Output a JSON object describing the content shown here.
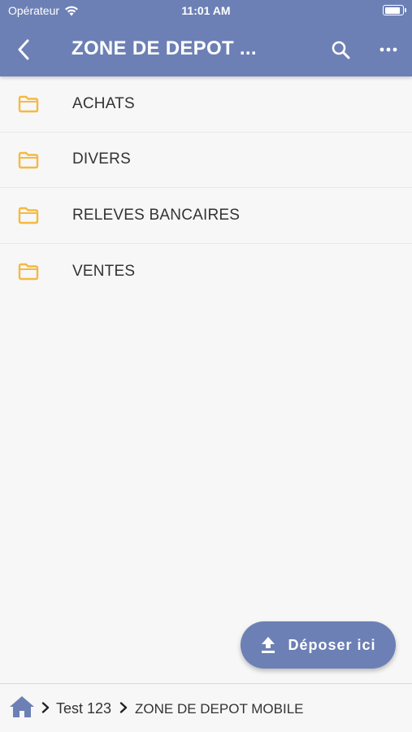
{
  "status": {
    "carrier": "Opérateur",
    "time": "11:01 AM",
    "battery_level": 0.9
  },
  "nav": {
    "title": "ZONE DE DEPOT ...",
    "back_icon": "chevron-left-icon",
    "search_icon": "search-icon",
    "more_icon": "more-horizontal-icon"
  },
  "folders": [
    {
      "label": "ACHATS",
      "icon": "folder-icon"
    },
    {
      "label": "DIVERS",
      "icon": "folder-icon"
    },
    {
      "label": "RELEVES BANCAIRES",
      "icon": "folder-icon"
    },
    {
      "label": "VENTES",
      "icon": "folder-icon"
    }
  ],
  "fab": {
    "label": "Déposer ici",
    "icon": "upload-icon"
  },
  "breadcrumb": {
    "home_icon": "home-icon",
    "items": [
      "Test 123",
      "ZONE DE DEPOT MOBILE"
    ]
  },
  "colors": {
    "primary": "#6c80b5",
    "folder": "#f5b942",
    "background": "#f7f7f7",
    "text": "#333333"
  }
}
